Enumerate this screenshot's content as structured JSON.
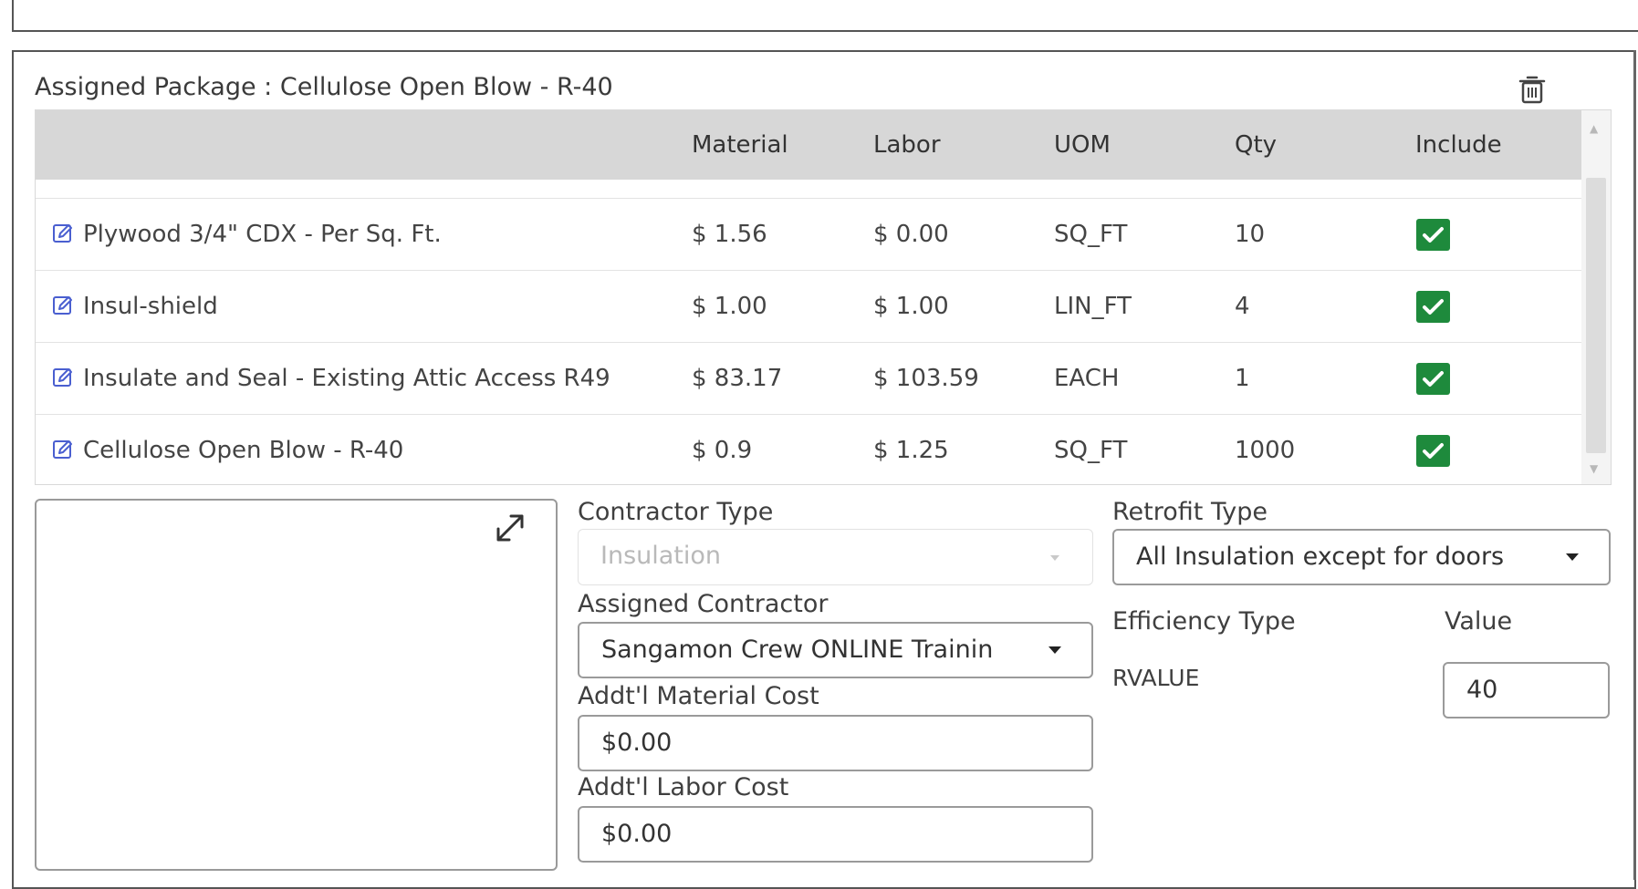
{
  "package": {
    "title": "Assigned Package : Cellulose Open Blow - R-40"
  },
  "table": {
    "columns": [
      "Material",
      "Labor",
      "UOM",
      "Qty",
      "Include"
    ],
    "rows": [
      {
        "name": "Plywood 3/4\" CDX - Per Sq. Ft.",
        "material": "$ 1.56",
        "labor": "$ 0.00",
        "uom": "SQ_FT",
        "qty": "10",
        "include": true
      },
      {
        "name": "Insul-shield",
        "material": "$ 1.00",
        "labor": "$ 1.00",
        "uom": "LIN_FT",
        "qty": "4",
        "include": true
      },
      {
        "name": "Insulate and Seal - Existing Attic Access R49",
        "material": "$ 83.17",
        "labor": "$ 103.59",
        "uom": "EACH",
        "qty": "1",
        "include": true
      },
      {
        "name": "Cellulose Open Blow - R-40",
        "material": "$ 0.9",
        "labor": "$ 1.25",
        "uom": "SQ_FT",
        "qty": "1000",
        "include": true
      }
    ]
  },
  "form": {
    "contractor_type_label": "Contractor Type",
    "contractor_type_value": "Insulation",
    "assigned_contractor_label": "Assigned Contractor",
    "assigned_contractor_value": "Sangamon Crew ONLINE Trainin",
    "material_cost_label": "Addt'l Material Cost",
    "material_cost_value": "$0.00",
    "labor_cost_label": "Addt'l Labor Cost",
    "labor_cost_value": "$0.00",
    "retrofit_type_label": "Retrofit Type",
    "retrofit_type_value": "All Insulation except for doors",
    "efficiency_type_label": "Efficiency Type",
    "value_label": "Value",
    "efficiency_type_value": "RVALUE",
    "value_value": "40"
  },
  "icons": {
    "delete": "trash-icon",
    "edit": "edit-icon",
    "expand": "expand-icon",
    "check": "checkbox-checked-icon"
  },
  "colors": {
    "header_bg": "#d7d7d7",
    "check_green": "#1e8a3c",
    "edit_icon": "#4a5fd0"
  }
}
